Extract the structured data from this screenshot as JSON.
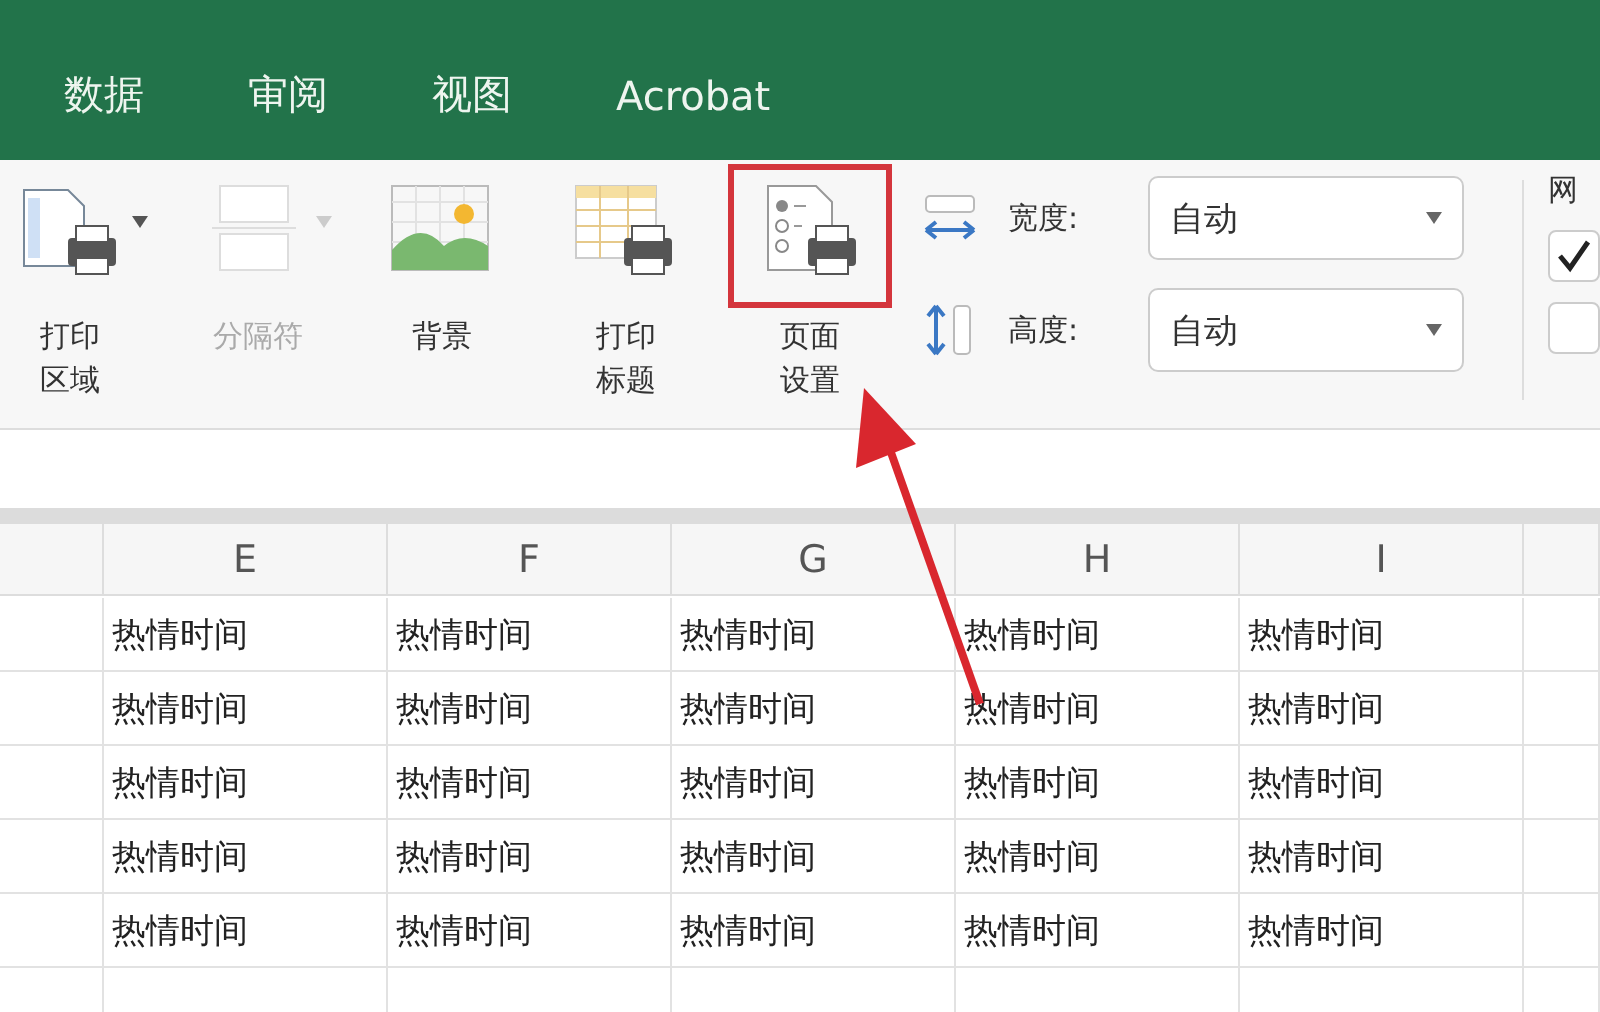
{
  "tabs": [
    {
      "label": "数据",
      "selected": false
    },
    {
      "label": "审阅",
      "selected": false
    },
    {
      "label": "视图",
      "selected": false
    },
    {
      "label": "Acrobat",
      "selected": false
    }
  ],
  "ribbon": {
    "buttons": [
      {
        "label": "打印区域",
        "kind": "print-area",
        "disabled": false,
        "dropdown": true,
        "highlighted": false
      },
      {
        "label": "分隔符",
        "kind": "breaks",
        "disabled": true,
        "dropdown": true,
        "highlighted": false
      },
      {
        "label": "背景",
        "kind": "background",
        "disabled": false,
        "dropdown": false,
        "highlighted": false
      },
      {
        "label": "打印标题",
        "kind": "print-titles",
        "disabled": false,
        "dropdown": false,
        "highlighted": false
      },
      {
        "label": "页面设置",
        "kind": "page-setup",
        "disabled": false,
        "dropdown": false,
        "highlighted": true
      }
    ],
    "scale_fields": [
      {
        "kind": "width",
        "label": "宽度:",
        "value": "自动"
      },
      {
        "kind": "height",
        "label": "高度:",
        "value": "自动"
      }
    ],
    "gridlines": {
      "label": "网",
      "checkboxes": [
        {
          "checked": true
        },
        {
          "checked": false
        }
      ]
    }
  },
  "sheet": {
    "columns": [
      "E",
      "F",
      "G",
      "H",
      "I"
    ],
    "rows": [
      [
        "热情时间",
        "热情时间",
        "热情时间",
        "热情时间",
        "热情时间"
      ],
      [
        "热情时间",
        "热情时间",
        "热情时间",
        "热情时间",
        "热情时间"
      ],
      [
        "热情时间",
        "热情时间",
        "热情时间",
        "热情时间",
        "热情时间"
      ],
      [
        "热情时间",
        "热情时间",
        "热情时间",
        "热情时间",
        "热情时间"
      ],
      [
        "热情时间",
        "热情时间",
        "热情时间",
        "热情时间",
        "热情时间"
      ]
    ]
  }
}
